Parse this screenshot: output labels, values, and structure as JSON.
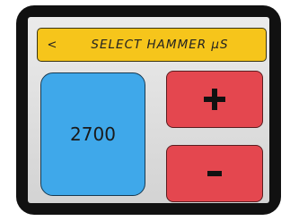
{
  "header": {
    "back_glyph": "<",
    "title": "SELECT HAMMER µS"
  },
  "value": {
    "current": "2700"
  },
  "controls": {
    "increase_icon": "plus-icon",
    "decrease_icon": "minus-icon"
  },
  "colors": {
    "header_bg": "#f6c51b",
    "value_bg": "#3fa8ea",
    "button_bg": "#e4474f",
    "frame": "#111111"
  }
}
